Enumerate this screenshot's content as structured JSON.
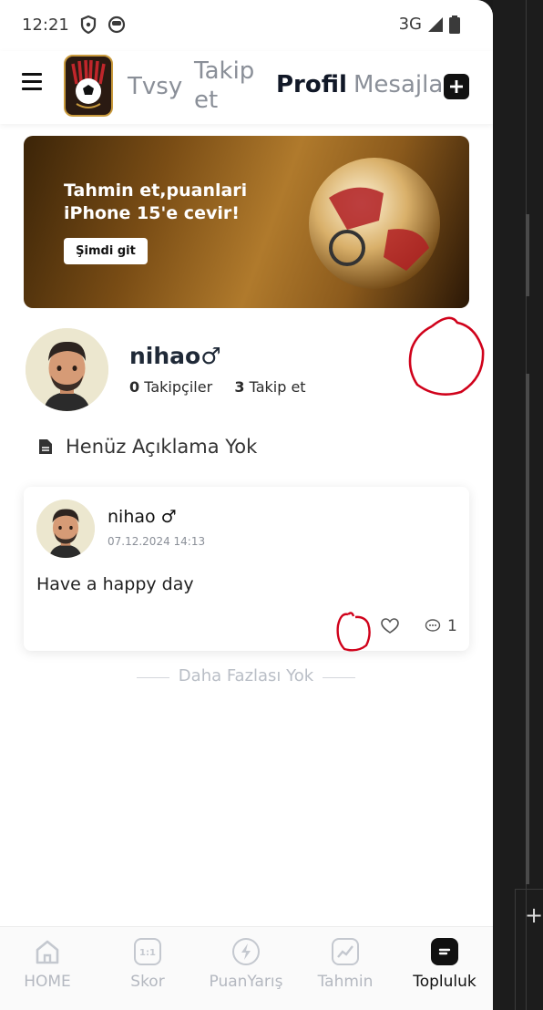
{
  "status": {
    "time": "12:21",
    "network": "3G"
  },
  "header": {
    "tabs": [
      {
        "label": "Tvsy"
      },
      {
        "label": "Takip et"
      },
      {
        "label": "Profil"
      },
      {
        "label": "Mesajlar"
      }
    ],
    "active_tab": "Profil"
  },
  "banner": {
    "line1": "Tahmin et,puanlari",
    "line2": "iPhone 15'e cevir!",
    "button": "Şimdi git"
  },
  "profile": {
    "name": "nihao",
    "gender_symbol": "♂",
    "followers_count": "0",
    "followers_label": "Takipçiler",
    "following_count": "3",
    "following_label": "Takip et",
    "description": "Henüz Açıklama Yok"
  },
  "post": {
    "user": "nihao ♂",
    "date": "07.12.2024 14:13",
    "text": "Have a happy day",
    "comment_count": "1"
  },
  "feed_end": "Daha Fazlası Yok",
  "bottom_nav": [
    {
      "label": "HOME",
      "icon": "home-icon"
    },
    {
      "label": "Skor",
      "icon": "scoreboard-icon"
    },
    {
      "label": "PuanYarış",
      "icon": "lightning-icon"
    },
    {
      "label": "Tahmin",
      "icon": "trend-chart-icon"
    },
    {
      "label": "Topluluk",
      "icon": "community-icon",
      "active": true
    }
  ],
  "colors": {
    "annotation": "#d0021b",
    "active_text": "#111827",
    "inactive_text": "#8a8f98"
  }
}
